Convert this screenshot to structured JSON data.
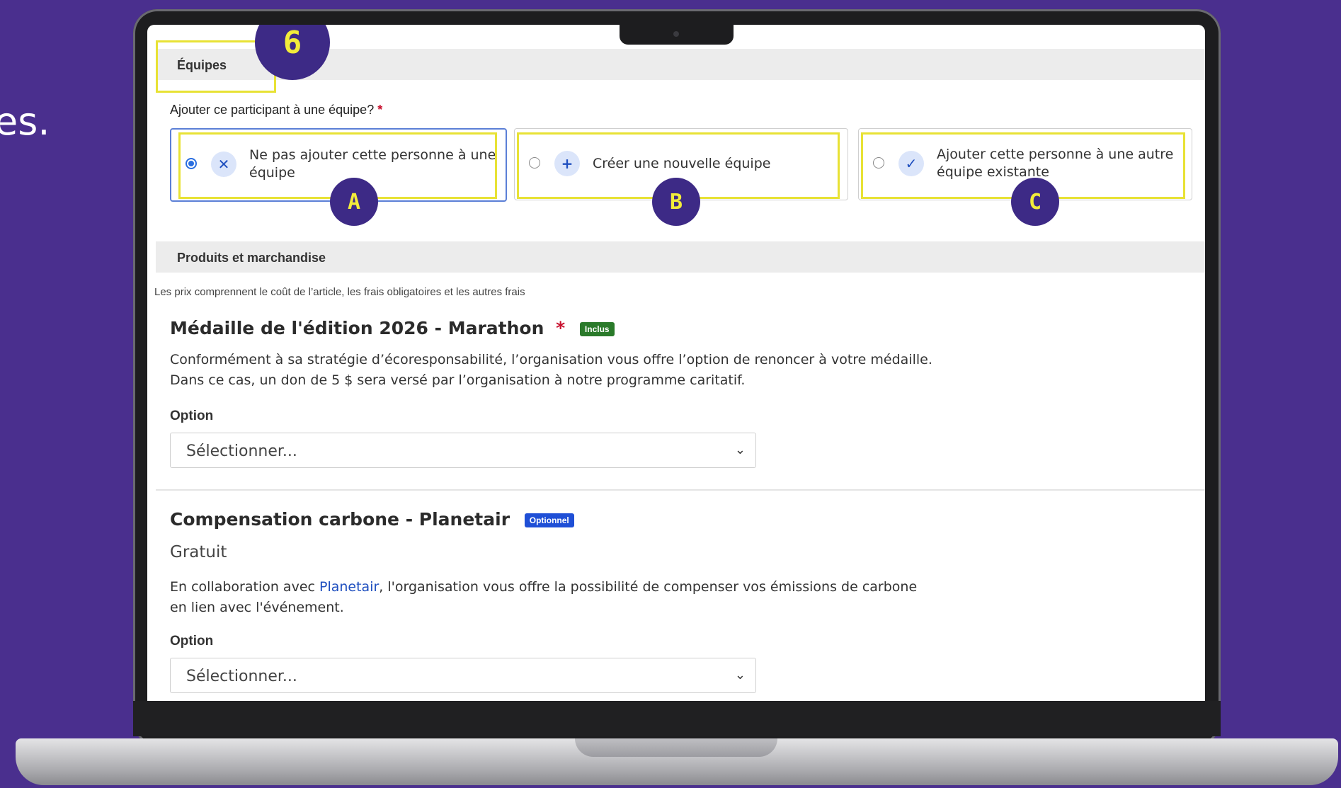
{
  "side_text": "es.",
  "sections": {
    "teams": {
      "header": "Équipes",
      "marker": "6",
      "question": "Ajouter ce participant à une équipe?",
      "required_mark": "*",
      "options": [
        {
          "label_line1": "Ne pas ajouter cette personne à une",
          "label_line2": "équipe",
          "icon": "x-icon",
          "glyph": "✕",
          "selected": true,
          "marker": "A"
        },
        {
          "label_line1": "Créer une nouvelle équipe",
          "label_line2": "",
          "icon": "plus-icon",
          "glyph": "+",
          "selected": false,
          "marker": "B"
        },
        {
          "label_line1": "Ajouter cette personne à une autre",
          "label_line2": "équipe existante",
          "icon": "check-icon",
          "glyph": "✓",
          "selected": false,
          "marker": "C"
        }
      ]
    },
    "products": {
      "header": "Produits et marchandise",
      "note": "Les prix comprennent le coût de l’article, les frais obligatoires et les autres frais",
      "items": [
        {
          "title": "Médaille de l'édition 2026 - Marathon",
          "required_mark": "*",
          "badge": "Inclus",
          "desc_line1": "Conformément à sa stratégie d’écoresponsabilité, l’organisation vous offre l’option de renoncer à votre médaille.",
          "desc_line2": "Dans ce cas, un don de 5 $ sera versé par l’organisation à notre programme caritatif.",
          "option_label": "Option",
          "select_value": "Sélectionner..."
        },
        {
          "title": "Compensation carbone - Planetair",
          "badge": "Optionnel",
          "price": "Gratuit",
          "desc_prefix": "En collaboration avec ",
          "desc_link": "Planetair",
          "desc_suffix": ", l'organisation vous offre la possibilité de compenser vos émissions de carbone",
          "desc_line2": "en lien avec l'événement.",
          "option_label": "Option",
          "select_value": "Sélectionner..."
        }
      ]
    }
  },
  "colors": {
    "background": "#4a2f8e",
    "highlight": "#e8e235",
    "marker_fill": "#3d2a86",
    "marker_text": "#f2ec3a",
    "badge_included": "#2a7a2a",
    "badge_optional": "#1f4fd6",
    "required": "#c8102e"
  }
}
